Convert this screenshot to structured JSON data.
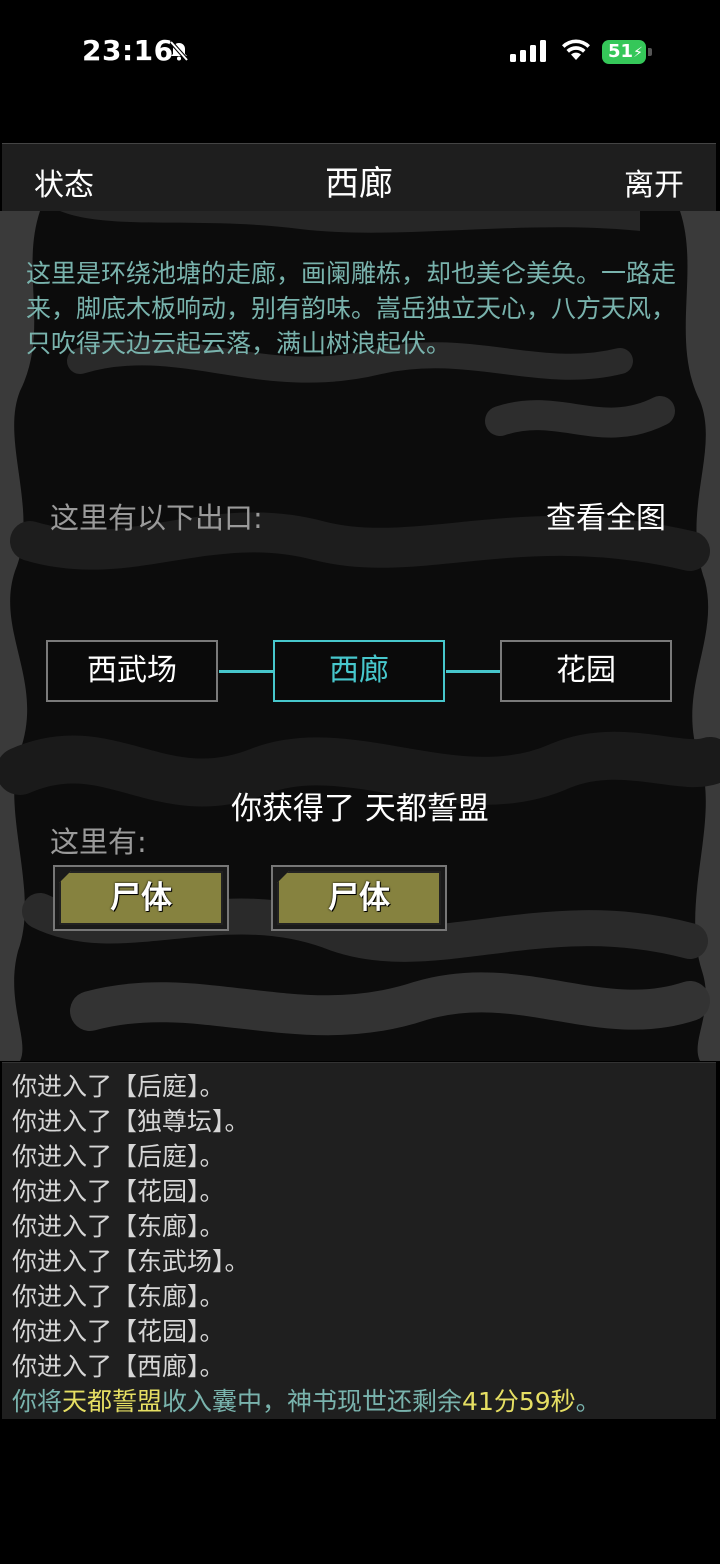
{
  "status_bar": {
    "time": "23:16",
    "battery": "51"
  },
  "header": {
    "left": "状态",
    "title": "西廊",
    "right": "离开"
  },
  "room": {
    "description": "这里是环绕池塘的走廊，画阑雕栋，却也美仑美奂。一路走来，脚底木板响动，别有韵味。嵩岳独立天心，八方天风，只吹得天边云起云落，满山树浪起伏。",
    "exits_label": "这里有以下出口:",
    "map_link": "查看全图",
    "exits": {
      "west": "西武场",
      "current": "西廊",
      "east": "花园"
    },
    "notice": "你获得了 天都誓盟",
    "here_label": "这里有:",
    "items": [
      "尸体",
      "尸体"
    ]
  },
  "log": {
    "lines": [
      "你进入了【后庭】。",
      "你进入了【独尊坛】。",
      "你进入了【后庭】。",
      "你进入了【花园】。",
      "你进入了【东廊】。",
      "你进入了【东武场】。",
      "你进入了【东廊】。",
      "你进入了【花园】。",
      "你进入了【西廊】。"
    ],
    "final": {
      "prefix": "你将",
      "item": "天都誓盟",
      "middle": "收入囊中，神书现世还剩余",
      "time": "41分59秒",
      "suffix": "。"
    }
  },
  "colors": {
    "accent": "#47c7cc",
    "description_text": "#79b3ad",
    "highlight": "#e6df63",
    "item_button": "#86823f",
    "battery": "#35c759"
  }
}
